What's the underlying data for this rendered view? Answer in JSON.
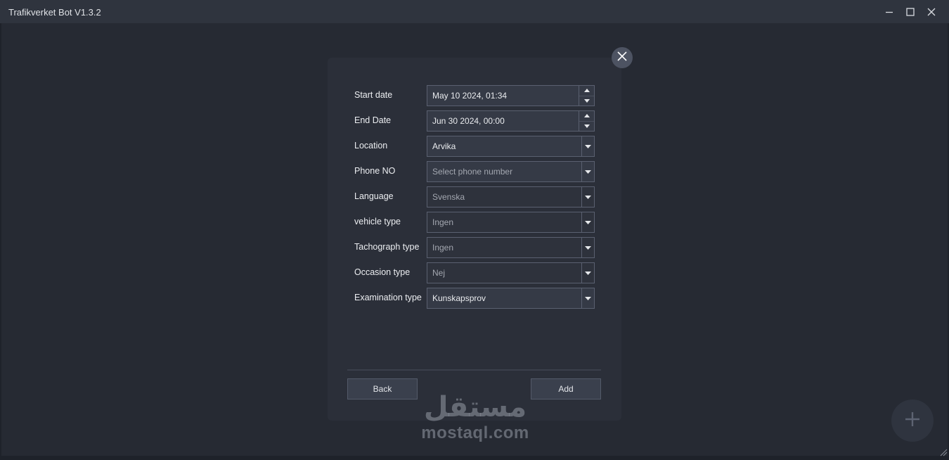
{
  "window": {
    "title": "Trafikverket Bot V1.3.2",
    "controls": {
      "minimize": "minimize-icon",
      "maximize": "maximize-icon",
      "close": "close-icon"
    }
  },
  "dialog": {
    "close_icon": "close-x-icon",
    "fields": {
      "start_date": {
        "label": "Start date",
        "value": "May 10 2024, 01:34"
      },
      "end_date": {
        "label": "End Date",
        "value": "Jun 30 2024, 00:00"
      },
      "location": {
        "label": "Location",
        "value": "Arvika"
      },
      "phone": {
        "label": "Phone NO",
        "placeholder": "Select phone number"
      },
      "language": {
        "label": "Language",
        "value": "Svenska"
      },
      "vehicle_type": {
        "label": "vehicle type",
        "value": "Ingen"
      },
      "tachograph_type": {
        "label": "Tachograph type",
        "value": "Ingen"
      },
      "occasion_type": {
        "label": "Occasion type",
        "value": "Nej"
      },
      "examination_type": {
        "label": "Examination type",
        "value": "Kunskapsprov"
      }
    },
    "buttons": {
      "back": "Back",
      "add": "Add"
    }
  },
  "fab": {
    "icon": "plus-icon"
  },
  "watermark": {
    "arabic": "مستقل",
    "latin": "mostaql.com"
  },
  "colors": {
    "background": "#262a33",
    "titlebar": "#2f343e",
    "dialog": "#2b2f39",
    "field": "#353a46",
    "button": "#3a404d"
  }
}
